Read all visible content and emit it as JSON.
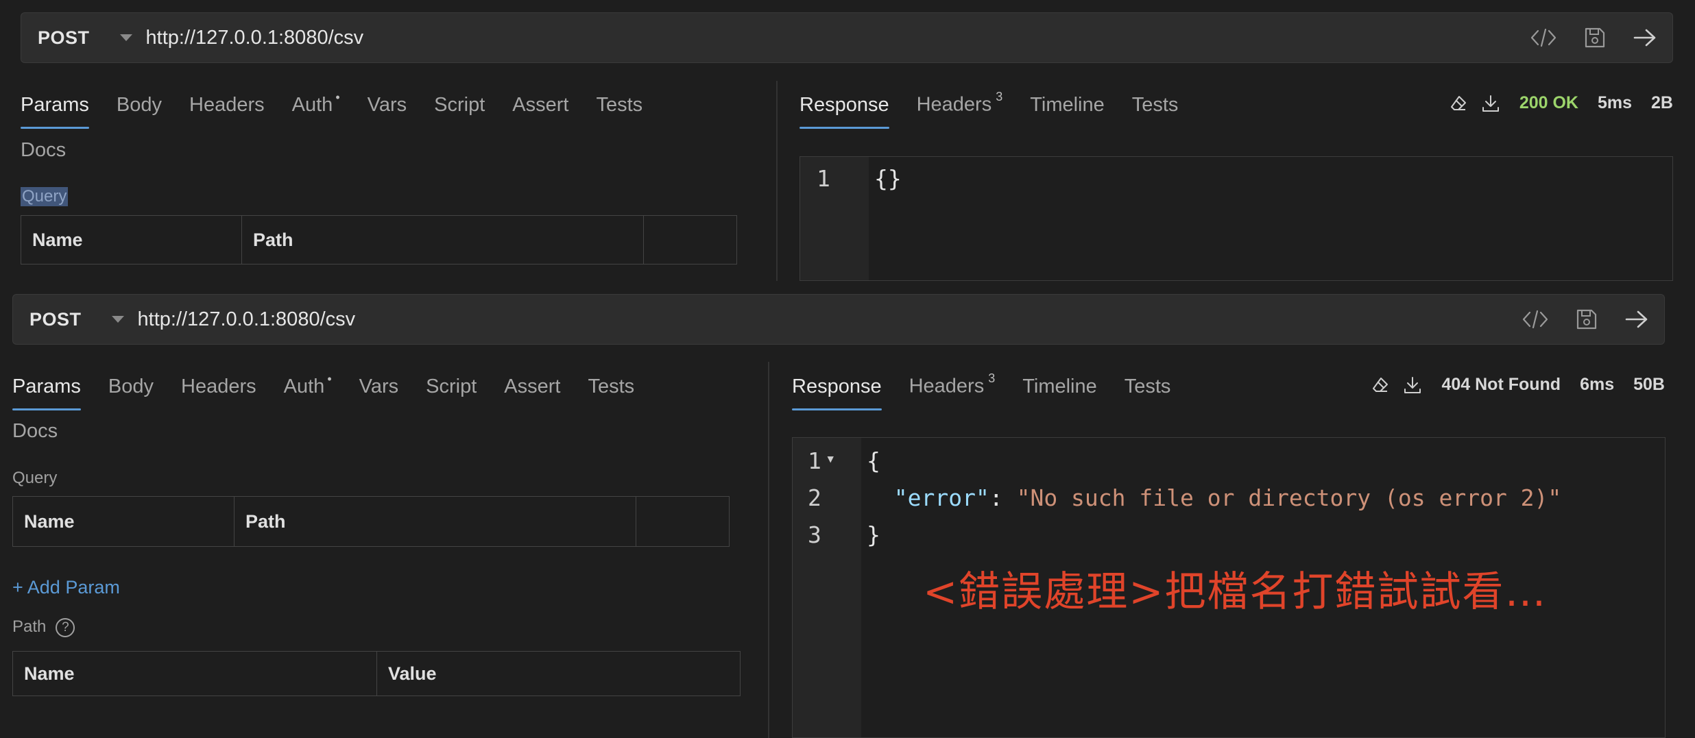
{
  "top": {
    "method": "POST",
    "url": "http://127.0.0.1:8080/csv",
    "request_tabs": [
      {
        "label": "Params"
      },
      {
        "label": "Body"
      },
      {
        "label": "Headers"
      },
      {
        "label": "Auth",
        "marker": "•"
      },
      {
        "label": "Vars"
      },
      {
        "label": "Script"
      },
      {
        "label": "Assert"
      },
      {
        "label": "Tests"
      }
    ],
    "docs_tab": "Docs",
    "query_label": "Query",
    "query_table_headers": [
      "Name",
      "Path"
    ],
    "response_tabs": [
      {
        "label": "Response"
      },
      {
        "label": "Headers",
        "count": "3"
      },
      {
        "label": "Timeline"
      },
      {
        "label": "Tests"
      }
    ],
    "status": "200 OK",
    "time": "5ms",
    "size": "2B",
    "response_lines": [
      {
        "no": "1",
        "text": "{}"
      }
    ]
  },
  "bottom": {
    "method": "POST",
    "url": "http://127.0.0.1:8080/csv",
    "request_tabs": [
      {
        "label": "Params"
      },
      {
        "label": "Body"
      },
      {
        "label": "Headers"
      },
      {
        "label": "Auth",
        "marker": "•"
      },
      {
        "label": "Vars"
      },
      {
        "label": "Script"
      },
      {
        "label": "Assert"
      },
      {
        "label": "Tests"
      }
    ],
    "docs_tab": "Docs",
    "query_label": "Query",
    "query_table_headers": [
      "Name",
      "Path"
    ],
    "add_param": "+ Add Param",
    "path_label": "Path",
    "help_glyph": "?",
    "path_table_headers": [
      "Name",
      "Value"
    ],
    "response_tabs": [
      {
        "label": "Response"
      },
      {
        "label": "Headers",
        "count": "3"
      },
      {
        "label": "Timeline"
      },
      {
        "label": "Tests"
      }
    ],
    "status": "404 Not Found",
    "time": "6ms",
    "size": "50B",
    "response_lines": [
      {
        "no": "1",
        "fold": "▾",
        "text": "{"
      },
      {
        "no": "2",
        "key": "\"error\"",
        "sep": ": ",
        "value": "\"No such file or directory (os error 2)\""
      },
      {
        "no": "3",
        "text": "}"
      }
    ],
    "annotation": "<錯誤處理>把檔名打錯試試看…"
  },
  "icons": {
    "generate_code": "code-icon",
    "save": "save-icon",
    "send": "arrow-right-icon",
    "clear": "eraser-icon",
    "download": "download-icon"
  },
  "colors": {
    "accent": "#5b9ad6",
    "status_ok": "#9cd46b",
    "annotation": "#e0442a",
    "json_key": "#9cdcfe",
    "json_string": "#ce9178"
  }
}
